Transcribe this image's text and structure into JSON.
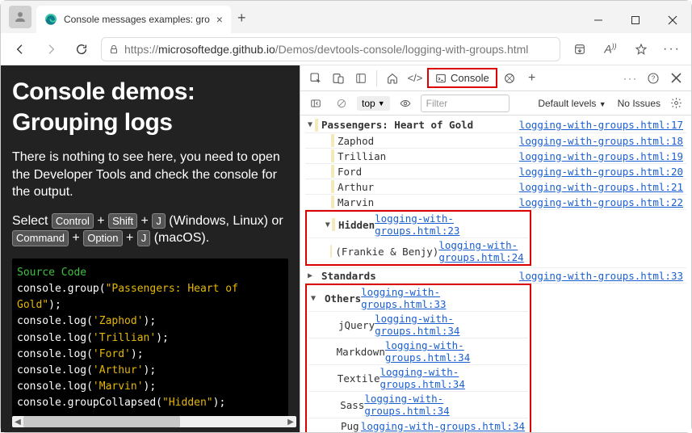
{
  "tab": {
    "title": "Console messages examples: gro"
  },
  "url": {
    "prefix": "https://",
    "host": "microsoftedge.github.io",
    "path": "/Demos/devtools-console/logging-with-groups.html"
  },
  "page": {
    "heading": "Console demos: Grouping logs",
    "para1": "There is nothing to see here, you need to open the Developer Tools and check the console for the output.",
    "select_prefix": "Select ",
    "kbd_ctrl": "Control",
    "kbd_shift": "Shift",
    "kbd_j": "J",
    "winlinux": " (Windows, Linux) or ",
    "kbd_cmd": "Command",
    "kbd_opt": "Option",
    "macos": " (macOS).",
    "source_label": "Source Code",
    "code_lines": [
      "console.group(\"Passengers: Heart of Gold\");",
      "console.log('Zaphod');",
      "console.log('Trillian');",
      "console.log('Ford');",
      "console.log('Arthur');",
      "console.log('Marvin');",
      "console.groupCollapsed(\"Hidden\");"
    ]
  },
  "devtools": {
    "console_tab": "Console",
    "top": "top",
    "filter_placeholder": "Filter",
    "levels": "Default levels",
    "noissues": "No Issues"
  },
  "console": {
    "rows": [
      {
        "type": "group",
        "indent": 0,
        "expanded": true,
        "text": "Passengers: Heart of Gold",
        "src": "logging-with-groups.html:17",
        "red": false
      },
      {
        "type": "log",
        "indent": 1,
        "text": "Zaphod",
        "src": "logging-with-groups.html:18"
      },
      {
        "type": "log",
        "indent": 1,
        "text": "Trillian",
        "src": "logging-with-groups.html:19"
      },
      {
        "type": "log",
        "indent": 1,
        "text": "Ford",
        "src": "logging-with-groups.html:20"
      },
      {
        "type": "log",
        "indent": 1,
        "text": "Arthur",
        "src": "logging-with-groups.html:21"
      },
      {
        "type": "log",
        "indent": 1,
        "text": "Marvin",
        "src": "logging-with-groups.html:22"
      },
      {
        "type": "group",
        "indent": 1,
        "expanded": true,
        "text": "Hidden",
        "src": "logging-with-groups.html:23",
        "red": true
      },
      {
        "type": "log",
        "indent": 2,
        "text": "(Frankie & Benjy)",
        "src": "logging-with-groups.html:24",
        "red": true
      },
      {
        "type": "group",
        "indent": 0,
        "expanded": false,
        "text": "Standards",
        "src": "logging-with-groups.html:33",
        "red": false,
        "nobar": true
      },
      {
        "type": "group",
        "indent": 0,
        "expanded": true,
        "text": "Others",
        "src": "logging-with-groups.html:33",
        "red": true,
        "nobar": true
      },
      {
        "type": "log",
        "indent": 1,
        "text": "jQuery",
        "src": "logging-with-groups.html:34",
        "nobar": true,
        "red": true
      },
      {
        "type": "log",
        "indent": 1,
        "text": "Markdown",
        "src": "logging-with-groups.html:34",
        "nobar": true,
        "red": true
      },
      {
        "type": "log",
        "indent": 1,
        "text": "Textile",
        "src": "logging-with-groups.html:34",
        "nobar": true,
        "red": true
      },
      {
        "type": "log",
        "indent": 1,
        "text": "Sass",
        "src": "logging-with-groups.html:34",
        "nobar": true,
        "red": true
      },
      {
        "type": "log",
        "indent": 1,
        "text": "Pug",
        "src": "logging-with-groups.html:34",
        "nobar": true,
        "red": true
      }
    ]
  }
}
